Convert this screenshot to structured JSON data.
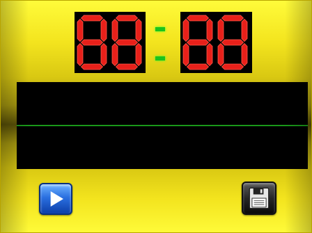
{
  "display": {
    "left_value": "88",
    "right_value": "88",
    "segment_color": "#e8201a",
    "colon_color": "#1cc31c"
  },
  "waveform": {
    "background": "#000000",
    "trace_color": "#22cc22",
    "trace_level": 0.5
  },
  "controls": {
    "play_icon": "play-icon",
    "save_icon": "floppy-disk-icon"
  },
  "theme": {
    "background_accent": "#f3e41e"
  }
}
